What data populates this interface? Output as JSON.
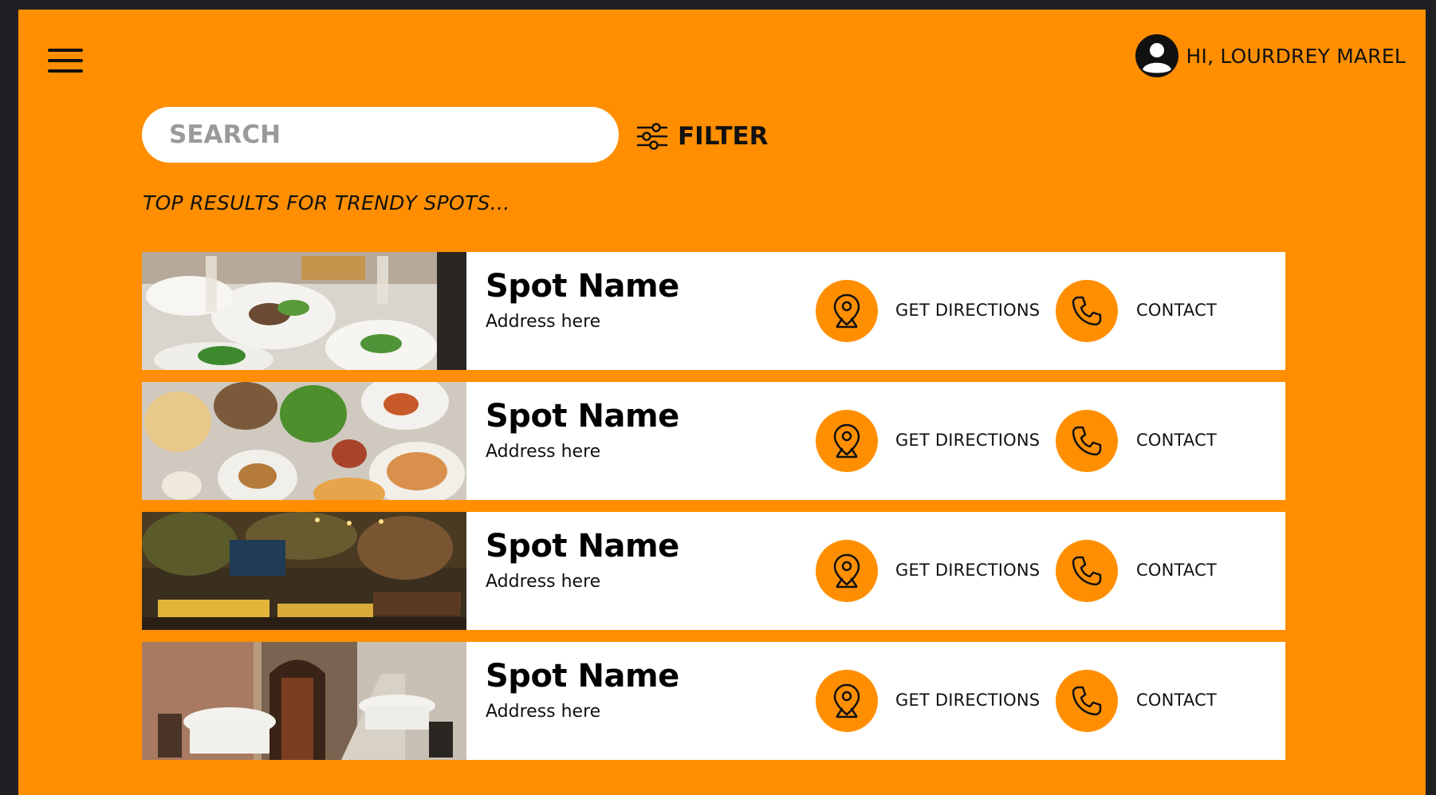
{
  "header": {
    "greeting": "HI, LOURDREY MAREL"
  },
  "search": {
    "placeholder": "SEARCH",
    "value": ""
  },
  "filter": {
    "label": "FILTER"
  },
  "results": {
    "heading": "TOP RESULTS FOR TRENDY SPOTS..."
  },
  "spots": [
    {
      "name": "Spot Name",
      "address": "Address here",
      "directions_label": "GET DIRECTIONS",
      "contact_label": "CONTACT"
    },
    {
      "name": "Spot Name",
      "address": "Address here",
      "directions_label": "GET DIRECTIONS",
      "contact_label": "CONTACT"
    },
    {
      "name": "Spot Name",
      "address": "Address here",
      "directions_label": "GET DIRECTIONS",
      "contact_label": "CONTACT"
    },
    {
      "name": "Spot Name",
      "address": "Address here",
      "directions_label": "GET DIRECTIONS",
      "contact_label": "CONTACT"
    }
  ],
  "colors": {
    "background": "#ff8f00",
    "frame": "#1f2023",
    "card": "#ffffff",
    "text": "#111111"
  },
  "icons": {
    "menu": "hamburger-icon",
    "user": "user-avatar-icon",
    "filter": "sliders-icon",
    "directions": "map-pin-icon",
    "contact": "phone-icon"
  }
}
